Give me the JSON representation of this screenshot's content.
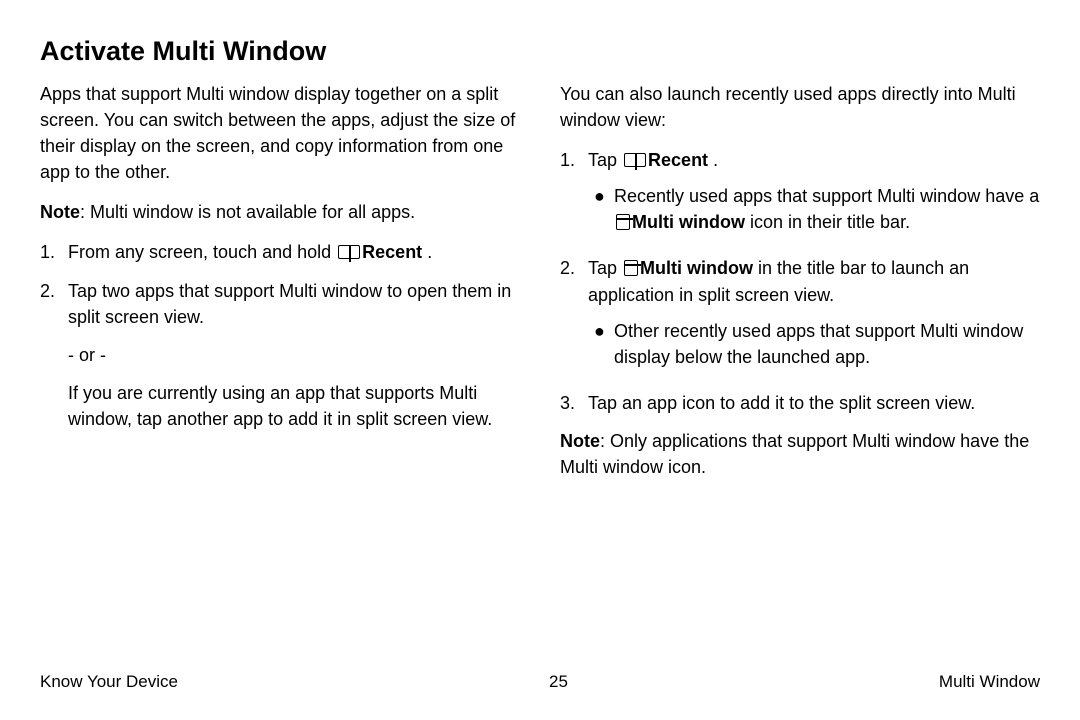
{
  "title": "Activate Multi Window",
  "left": {
    "intro": "Apps that support Multi window display together on a split screen. You can switch between the apps, adjust the size of their display on the screen, and copy information from one app to the other.",
    "note_label": "Note",
    "note_text": ": Multi window is not available for all apps.",
    "step1_prefix": "From any screen, touch and hold ",
    "step1_bold": "Recent",
    "step1_suffix": " .",
    "step2_text": "Tap two apps that support Multi window to open them in split screen view.",
    "or": "- or -",
    "step2_alt": "If you are currently using an app that supports Multi window, tap another app to add it in split screen view."
  },
  "right": {
    "intro": "You can also launch recently used apps directly into Multi window view:",
    "step1_prefix": "Tap ",
    "step1_bold": "Recent",
    "step1_suffix": " .",
    "bullet1_a": "Recently used apps that support Multi window have a ",
    "bullet1_bold": "Multi  window",
    "bullet1_b": " icon in their title bar.",
    "step2_prefix": "Tap ",
    "step2_bold": "Multi  window",
    "step2_suffix": " in the title bar to launch an application in split screen view.",
    "bullet2": "Other recently used apps that support Multi window display below the launched app.",
    "step3": "Tap an app icon to add it to the split screen view.",
    "note_label": "Note",
    "note_text": ": Only applications that support Multi window have the Multi window icon."
  },
  "footer": {
    "left": "Know Your Device",
    "center": "25",
    "right": "Multi Window"
  }
}
